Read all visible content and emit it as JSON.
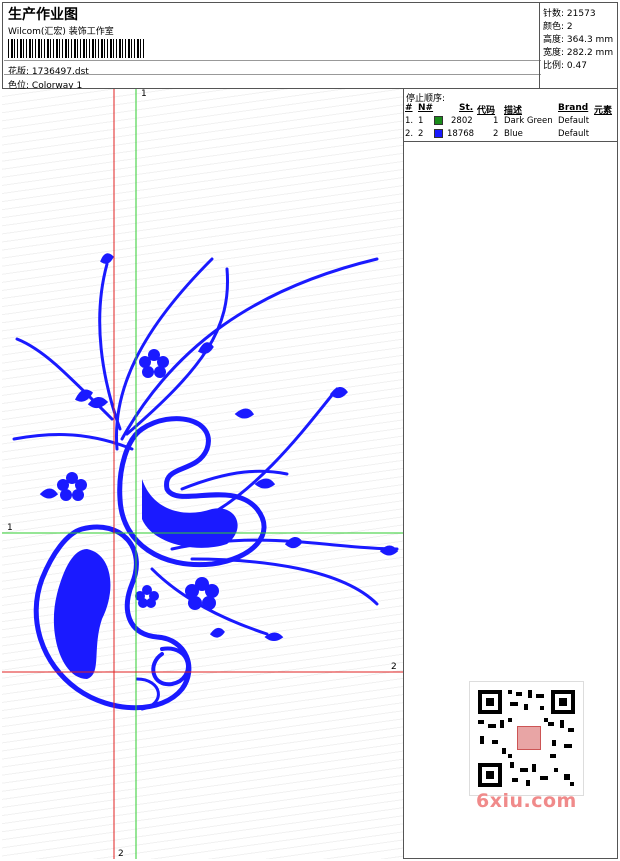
{
  "header": {
    "title": "生产作业图",
    "company": "Wilcom(汇宏) 装饰工作室",
    "design_label": "花版:",
    "design_file": "1736497.dst",
    "colorway_label": "色位:",
    "colorway": "Colorway 1"
  },
  "stats": [
    {
      "key": "针数:",
      "value": "21573"
    },
    {
      "key": "颜色:",
      "value": "2"
    },
    {
      "key": "高度:",
      "value": "364.3 mm"
    },
    {
      "key": "宽度:",
      "value": "282.2 mm"
    },
    {
      "key": "比例:",
      "value": "0.47"
    }
  ],
  "stop_sequence": {
    "title": "停止顺序:",
    "columns": [
      "#",
      "N#",
      "St.",
      "代码",
      "描述",
      "Brand",
      "元素"
    ],
    "rows": [
      {
        "num": "1.",
        "needle": "1",
        "stitches": "2802",
        "code": "1",
        "description": "Dark Green",
        "brand": "Default",
        "color": "#1a8c1a"
      },
      {
        "num": "2.",
        "needle": "2",
        "stitches": "18768",
        "code": "2",
        "description": "Blue",
        "brand": "Default",
        "color": "#1a1aff"
      }
    ]
  },
  "guides": {
    "vertical_green_label": "1",
    "horizontal_green_label": "1",
    "vertical_red_label": "2",
    "horizontal_red_label": "2",
    "green_color": "#2ecc2e",
    "red_color": "#e02020"
  },
  "design": {
    "thread_color": "#1a1aff"
  },
  "watermark": {
    "text": "6xiu.com",
    "color": "#f08a8a"
  }
}
